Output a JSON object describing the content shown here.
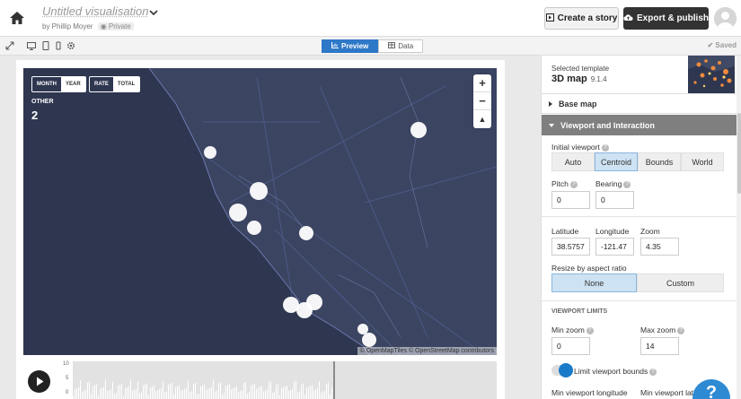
{
  "header": {
    "title": "Untitled visualisation",
    "byline": "by Phillip Moyer",
    "privacy_badge": "Private",
    "create_story_label": "Create a story",
    "export_label": "Export & publish"
  },
  "toolbar": {
    "tabs": [
      {
        "label": "Preview",
        "active": true
      },
      {
        "label": "Data",
        "active": false
      }
    ],
    "saved_label": "Saved"
  },
  "map": {
    "period_toggle": [
      "MONTH",
      "YEAR"
    ],
    "period_selected": "YEAR",
    "measure_toggle": [
      "RATE",
      "TOTAL"
    ],
    "measure_selected": "TOTAL",
    "category_label": "OTHER",
    "category_value": "2",
    "zoom_in": "+",
    "zoom_out": "−",
    "attribution": "© OpenMapTiles © OpenStreetMap contributors",
    "bg_color": "#3b4562",
    "marker_color": "#ffffff"
  },
  "timeline": {
    "y_ticks": [
      "10",
      "5",
      "0"
    ]
  },
  "sidebar": {
    "template_label": "Selected template",
    "template_name": "3D map",
    "template_version": "9.1.4",
    "sections": {
      "base_map": "Base map",
      "viewport": "Viewport and Interaction"
    },
    "initial_viewport_label": "Initial viewport",
    "viewport_options": [
      "Auto",
      "Centroid",
      "Bounds",
      "World"
    ],
    "viewport_selected": "Centroid",
    "pitch_label": "Pitch",
    "pitch_value": "0",
    "bearing_label": "Bearing",
    "bearing_value": "0",
    "latitude_label": "Latitude",
    "latitude_value": "38.5757",
    "longitude_label": "Longitude",
    "longitude_value": "-121.47",
    "zoom_label": "Zoom",
    "zoom_value": "4.35",
    "resize_label": "Resize by aspect ratio",
    "resize_options": [
      "None",
      "Custom"
    ],
    "resize_selected": "None",
    "limits_heading": "VIEWPORT LIMITS",
    "min_zoom_label": "Min zoom",
    "min_zoom_value": "0",
    "max_zoom_label": "Max zoom",
    "max_zoom_value": "14",
    "limit_bounds_label": "Limit viewport bounds",
    "min_lon_label": "Min viewport longitude",
    "min_lat_label": "Min viewport lati",
    "accent_color": "#2e78c8"
  },
  "help_bubble": "?"
}
